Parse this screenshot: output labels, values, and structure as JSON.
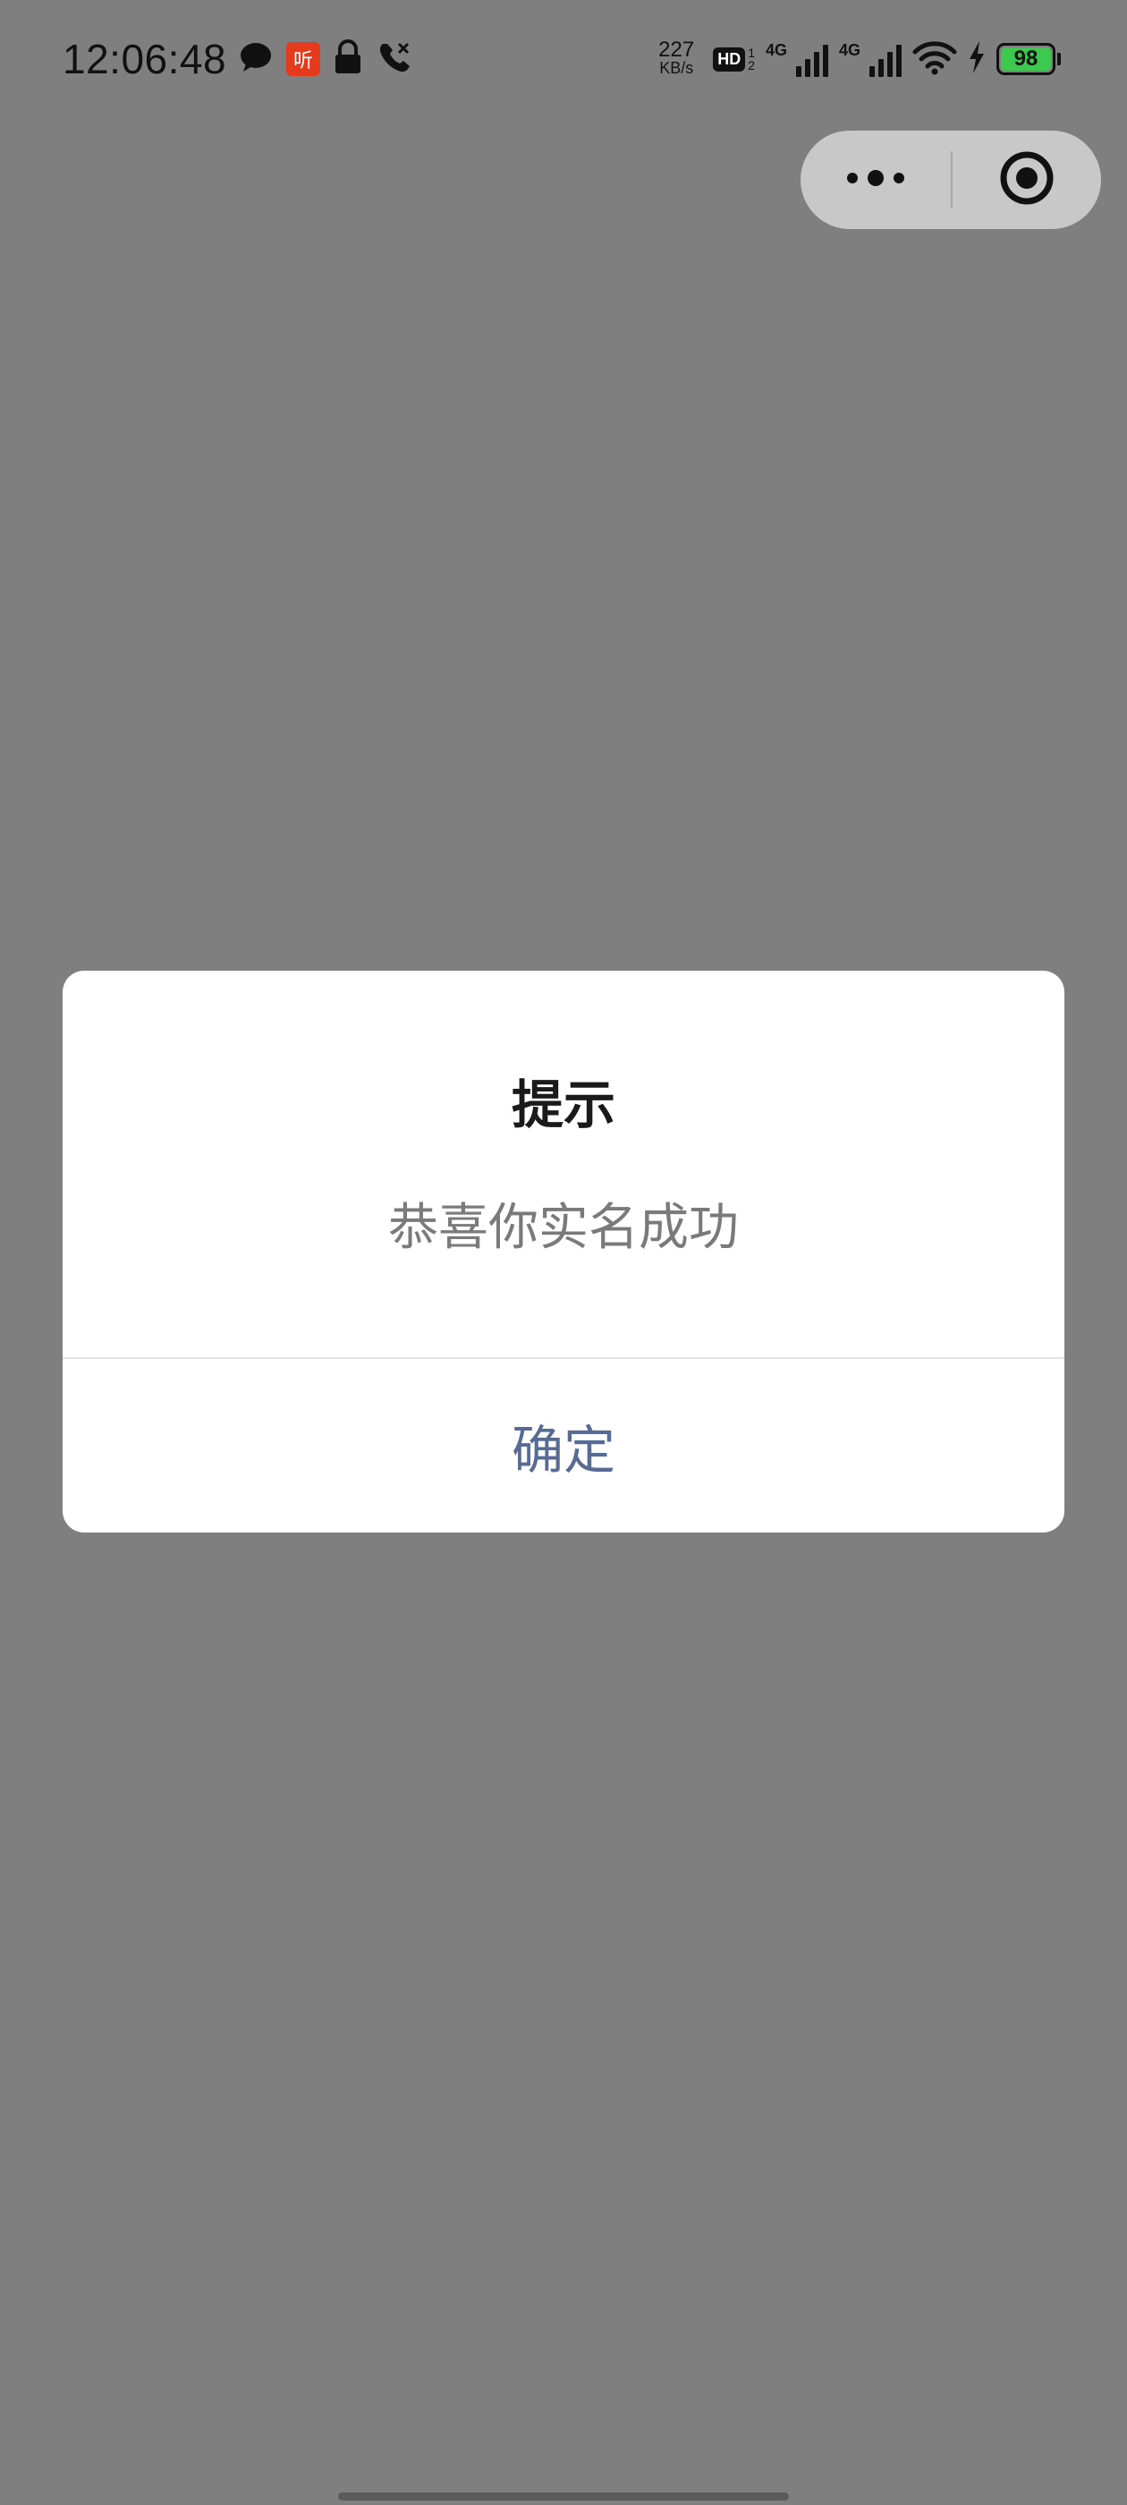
{
  "status_bar": {
    "time": "12:06:48",
    "ting_label": "听",
    "net_speed_value": "227",
    "net_speed_unit": "KB/s",
    "hd_label": "HD",
    "hd_sub_top": "1",
    "hd_sub_bottom": "2",
    "signal1_label": "4G",
    "signal2_label": "4G",
    "battery_level": "98",
    "colors": {
      "battery_fill": "#3cc94d",
      "ting_badge": "#e53a1c"
    }
  },
  "capsule": {
    "more_icon": "more-dots-icon",
    "close_icon": "target-close-icon"
  },
  "dialog": {
    "title": "提示",
    "message": "恭喜你实名成功",
    "confirm_label": "确定",
    "confirm_color": "#576b95"
  }
}
